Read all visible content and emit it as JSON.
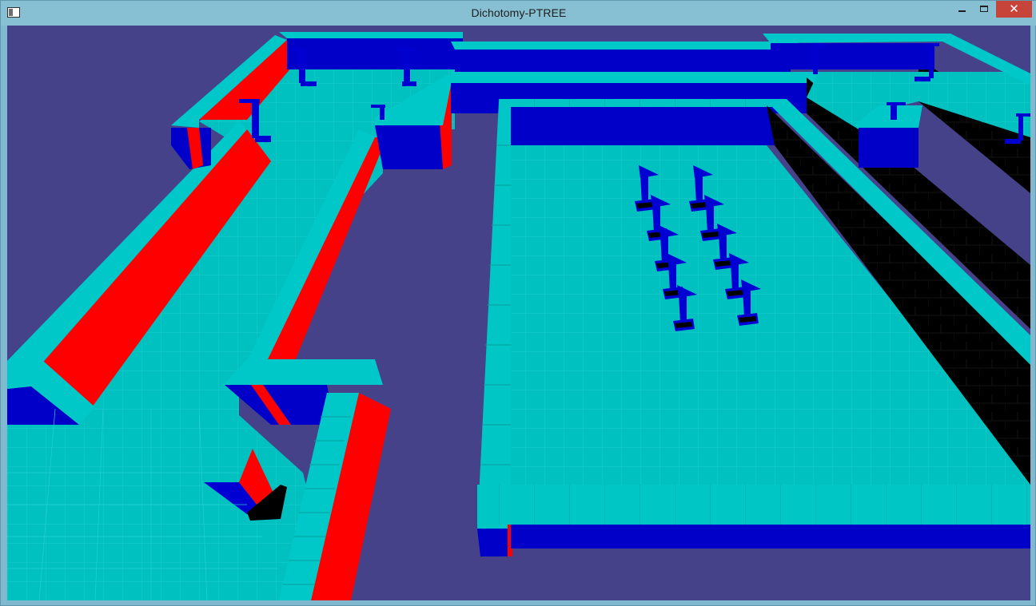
{
  "window": {
    "title": "Dichotomy-PTREE",
    "app_icon": "window-app-icon",
    "controls": {
      "minimize_icon": "minimize-icon",
      "maximize_icon": "maximize-icon",
      "close_label": "✕"
    }
  },
  "scene": {
    "background_color": "#45428a",
    "floor_color": "#00c0c0",
    "wall_top_color": "#00c6c6",
    "wall_face_blue": "#0000c8",
    "wall_face_red": "#ff0000",
    "wall_face_black": "#000000",
    "pillar_color": "#0000d2"
  }
}
